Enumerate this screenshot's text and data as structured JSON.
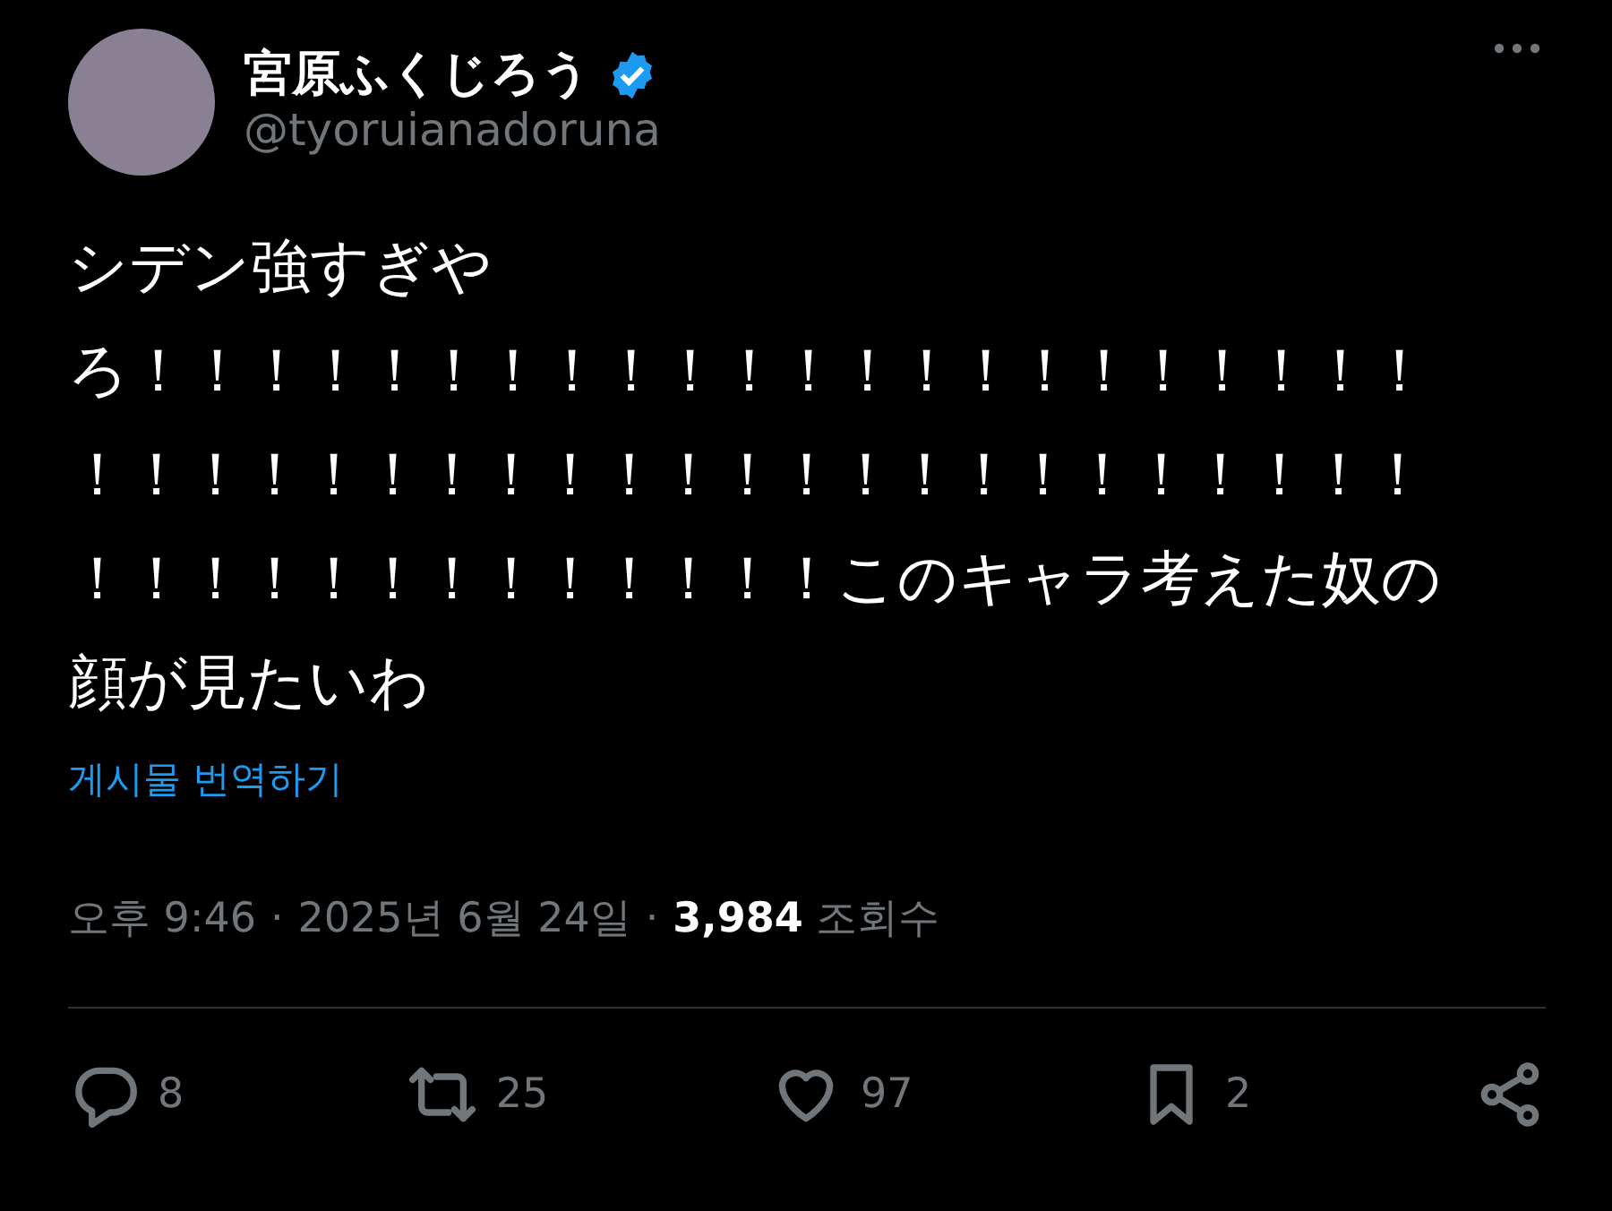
{
  "author": {
    "name": "宮原ふくじろう",
    "verified": true,
    "handle": "@tyoruianadoruna"
  },
  "text_lines": [
    "シデン強すぎや",
    "ろ！！！！！！！！！！！！！！！！！！！！！！",
    "！！！！！！！！！！！！！！！！！！！！！！！",
    "！！！！！！！！！！！！！このキャラ考えた奴の",
    "顔が見たいわ"
  ],
  "translate_link": "게시물 번역하기",
  "meta": {
    "time": "오후 9:46",
    "separator": "·",
    "date": "2025년 6월 24일",
    "views": "3,984",
    "views_label": "조회수"
  },
  "actions": [
    {
      "kind": "reply",
      "count": "8"
    },
    {
      "kind": "repost",
      "count": "25"
    },
    {
      "kind": "like",
      "count": "97"
    },
    {
      "kind": "bookmark",
      "count": "2"
    },
    {
      "kind": "share"
    }
  ]
}
